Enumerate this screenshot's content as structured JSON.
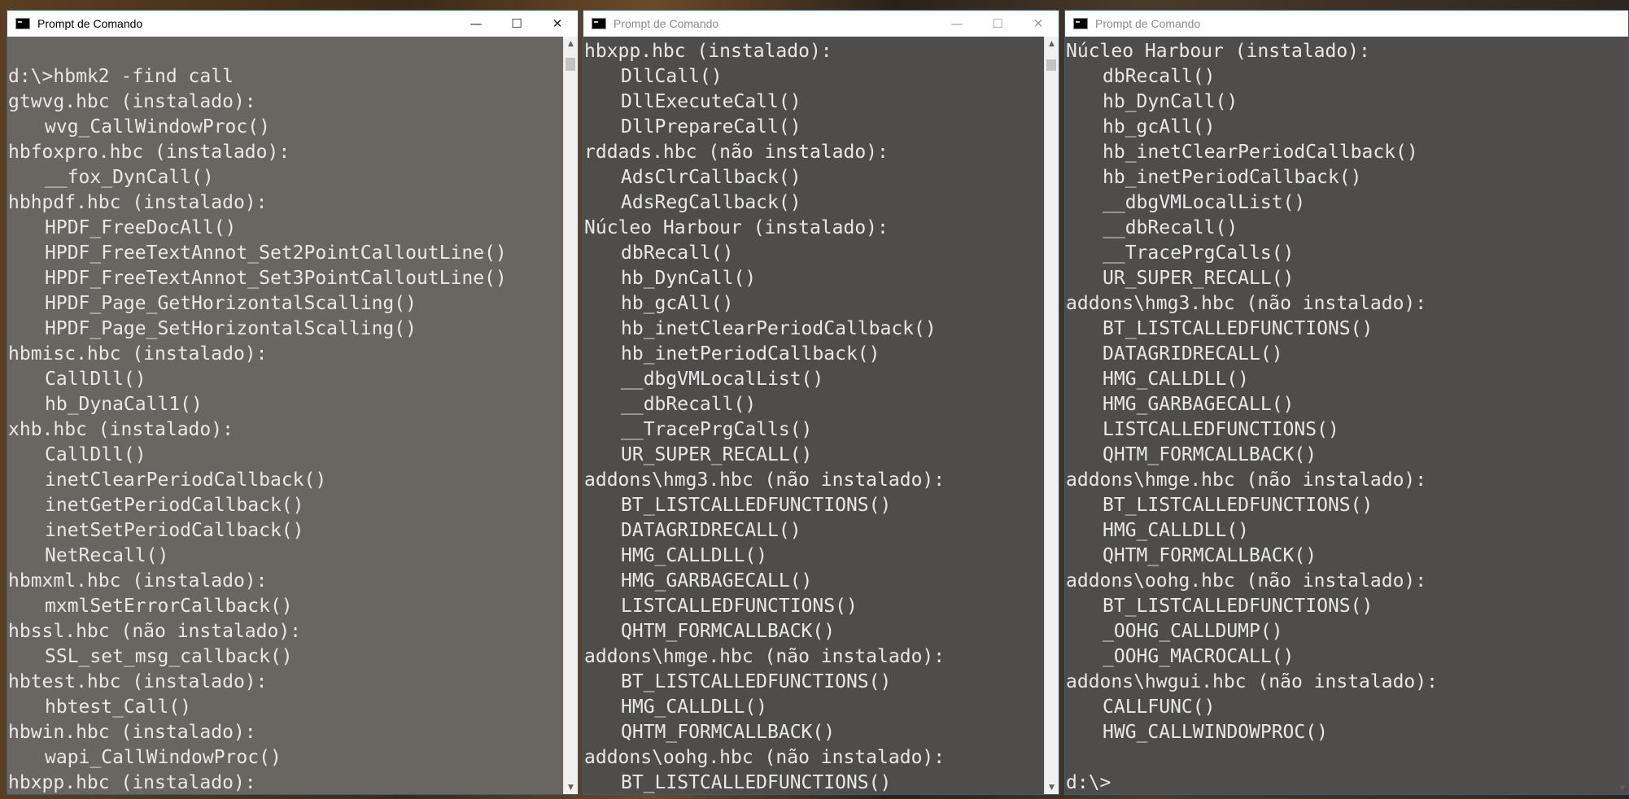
{
  "windows": [
    {
      "title": "Prompt de Comando",
      "active": true,
      "lines": [
        {
          "text": "",
          "indent": false
        },
        {
          "text": "d:\\>hbmk2 -find call",
          "indent": false
        },
        {
          "text": "gtwvg.hbc (instalado):",
          "indent": false
        },
        {
          "text": "wvg_CallWindowProc()",
          "indent": true
        },
        {
          "text": "hbfoxpro.hbc (instalado):",
          "indent": false
        },
        {
          "text": "__fox_DynCall()",
          "indent": true
        },
        {
          "text": "hbhpdf.hbc (instalado):",
          "indent": false
        },
        {
          "text": "HPDF_FreeDocAll()",
          "indent": true
        },
        {
          "text": "HPDF_FreeTextAnnot_Set2PointCalloutLine()",
          "indent": true
        },
        {
          "text": "HPDF_FreeTextAnnot_Set3PointCalloutLine()",
          "indent": true
        },
        {
          "text": "HPDF_Page_GetHorizontalScalling()",
          "indent": true
        },
        {
          "text": "HPDF_Page_SetHorizontalScalling()",
          "indent": true
        },
        {
          "text": "hbmisc.hbc (instalado):",
          "indent": false
        },
        {
          "text": "CallDll()",
          "indent": true
        },
        {
          "text": "hb_DynaCall1()",
          "indent": true
        },
        {
          "text": "xhb.hbc (instalado):",
          "indent": false
        },
        {
          "text": "CallDll()",
          "indent": true
        },
        {
          "text": "inetClearPeriodCallback()",
          "indent": true
        },
        {
          "text": "inetGetPeriodCallback()",
          "indent": true
        },
        {
          "text": "inetSetPeriodCallback()",
          "indent": true
        },
        {
          "text": "NetRecall()",
          "indent": true
        },
        {
          "text": "hbmxml.hbc (instalado):",
          "indent": false
        },
        {
          "text": "mxmlSetErrorCallback()",
          "indent": true
        },
        {
          "text": "hbssl.hbc (não instalado):",
          "indent": false
        },
        {
          "text": "SSL_set_msg_callback()",
          "indent": true
        },
        {
          "text": "hbtest.hbc (instalado):",
          "indent": false
        },
        {
          "text": "hbtest_Call()",
          "indent": true
        },
        {
          "text": "hbwin.hbc (instalado):",
          "indent": false
        },
        {
          "text": "wapi_CallWindowProc()",
          "indent": true
        },
        {
          "text": "hbxpp.hbc (instalado):",
          "indent": false
        }
      ]
    },
    {
      "title": "Prompt de Comando",
      "active": false,
      "lines": [
        {
          "text": "hbxpp.hbc (instalado):",
          "indent": false
        },
        {
          "text": "DllCall()",
          "indent": true
        },
        {
          "text": "DllExecuteCall()",
          "indent": true
        },
        {
          "text": "DllPrepareCall()",
          "indent": true
        },
        {
          "text": "rddads.hbc (não instalado):",
          "indent": false
        },
        {
          "text": "AdsClrCallback()",
          "indent": true
        },
        {
          "text": "AdsRegCallback()",
          "indent": true
        },
        {
          "text": "Núcleo Harbour (instalado):",
          "indent": false
        },
        {
          "text": "dbRecall()",
          "indent": true
        },
        {
          "text": "hb_DynCall()",
          "indent": true
        },
        {
          "text": "hb_gcAll()",
          "indent": true
        },
        {
          "text": "hb_inetClearPeriodCallback()",
          "indent": true
        },
        {
          "text": "hb_inetPeriodCallback()",
          "indent": true
        },
        {
          "text": "__dbgVMLocalList()",
          "indent": true
        },
        {
          "text": "__dbRecall()",
          "indent": true
        },
        {
          "text": "__TracePrgCalls()",
          "indent": true
        },
        {
          "text": "UR_SUPER_RECALL()",
          "indent": true
        },
        {
          "text": "addons\\hmg3.hbc (não instalado):",
          "indent": false
        },
        {
          "text": "BT_LISTCALLEDFUNCTIONS()",
          "indent": true
        },
        {
          "text": "DATAGRIDRECALL()",
          "indent": true
        },
        {
          "text": "HMG_CALLDLL()",
          "indent": true
        },
        {
          "text": "HMG_GARBAGECALL()",
          "indent": true
        },
        {
          "text": "LISTCALLEDFUNCTIONS()",
          "indent": true
        },
        {
          "text": "QHTM_FORMCALLBACK()",
          "indent": true
        },
        {
          "text": "addons\\hmge.hbc (não instalado):",
          "indent": false
        },
        {
          "text": "BT_LISTCALLEDFUNCTIONS()",
          "indent": true
        },
        {
          "text": "HMG_CALLDLL()",
          "indent": true
        },
        {
          "text": "QHTM_FORMCALLBACK()",
          "indent": true
        },
        {
          "text": "addons\\oohg.hbc (não instalado):",
          "indent": false
        },
        {
          "text": "BT_LISTCALLEDFUNCTIONS()",
          "indent": true
        }
      ]
    },
    {
      "title": "Prompt de Comando",
      "active": false,
      "lines": [
        {
          "text": "Núcleo Harbour (instalado):",
          "indent": false
        },
        {
          "text": "dbRecall()",
          "indent": true
        },
        {
          "text": "hb_DynCall()",
          "indent": true
        },
        {
          "text": "hb_gcAll()",
          "indent": true
        },
        {
          "text": "hb_inetClearPeriodCallback()",
          "indent": true
        },
        {
          "text": "hb_inetPeriodCallback()",
          "indent": true
        },
        {
          "text": "__dbgVMLocalList()",
          "indent": true
        },
        {
          "text": "__dbRecall()",
          "indent": true
        },
        {
          "text": "__TracePrgCalls()",
          "indent": true
        },
        {
          "text": "UR_SUPER_RECALL()",
          "indent": true
        },
        {
          "text": "addons\\hmg3.hbc (não instalado):",
          "indent": false
        },
        {
          "text": "BT_LISTCALLEDFUNCTIONS()",
          "indent": true
        },
        {
          "text": "DATAGRIDRECALL()",
          "indent": true
        },
        {
          "text": "HMG_CALLDLL()",
          "indent": true
        },
        {
          "text": "HMG_GARBAGECALL()",
          "indent": true
        },
        {
          "text": "LISTCALLEDFUNCTIONS()",
          "indent": true
        },
        {
          "text": "QHTM_FORMCALLBACK()",
          "indent": true
        },
        {
          "text": "addons\\hmge.hbc (não instalado):",
          "indent": false
        },
        {
          "text": "BT_LISTCALLEDFUNCTIONS()",
          "indent": true
        },
        {
          "text": "HMG_CALLDLL()",
          "indent": true
        },
        {
          "text": "QHTM_FORMCALLBACK()",
          "indent": true
        },
        {
          "text": "addons\\oohg.hbc (não instalado):",
          "indent": false
        },
        {
          "text": "BT_LISTCALLEDFUNCTIONS()",
          "indent": true
        },
        {
          "text": "_OOHG_CALLDUMP()",
          "indent": true
        },
        {
          "text": "_OOHG_MACROCALL()",
          "indent": true
        },
        {
          "text": "addons\\hwgui.hbc (não instalado):",
          "indent": false
        },
        {
          "text": "CALLFUNC()",
          "indent": true
        },
        {
          "text": "HWG_CALLWINDOWPROC()",
          "indent": true
        },
        {
          "text": "",
          "indent": false
        },
        {
          "text": "d:\\>",
          "indent": false
        }
      ]
    }
  ],
  "icons": {
    "app": "console-app-icon",
    "minimize": "minimize-icon",
    "maximize": "maximize-icon",
    "close": "close-icon",
    "scroll_up": "scroll-up-arrow-icon",
    "scroll_down": "scroll-down-arrow-icon"
  },
  "colors": {
    "console_text": "#e8e8e8",
    "titlebar": "#ffffff",
    "window_border": "#3c5a7a"
  }
}
